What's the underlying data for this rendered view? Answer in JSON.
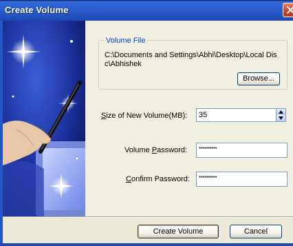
{
  "window": {
    "title": "Create Volume"
  },
  "icons": {
    "close": "close-icon",
    "spin_up": "up-arrow-icon",
    "spin_down": "down-arrow-icon"
  },
  "volume_file": {
    "legend": "Volume File",
    "path": "C:\\Documents and Settings\\Abhi\\Desktop\\Local Disc\\Abhishek",
    "browse_label": "Browse..."
  },
  "size": {
    "label_pre": "",
    "label_mnemonic": "S",
    "label_post": "ize of New Volume(MB):",
    "value": "35"
  },
  "password": {
    "label_pre": "Volume ",
    "label_mnemonic": "P",
    "label_post": "assword:",
    "value": "**********"
  },
  "confirm": {
    "label_pre": "",
    "label_mnemonic": "C",
    "label_post": "onfirm Password:",
    "value": "**********"
  },
  "buttons": {
    "create": "Create Volume",
    "cancel": "Cancel"
  },
  "colors": {
    "titlebar": "#2456C4",
    "legend": "#0046D5",
    "close": "#C8452A"
  }
}
